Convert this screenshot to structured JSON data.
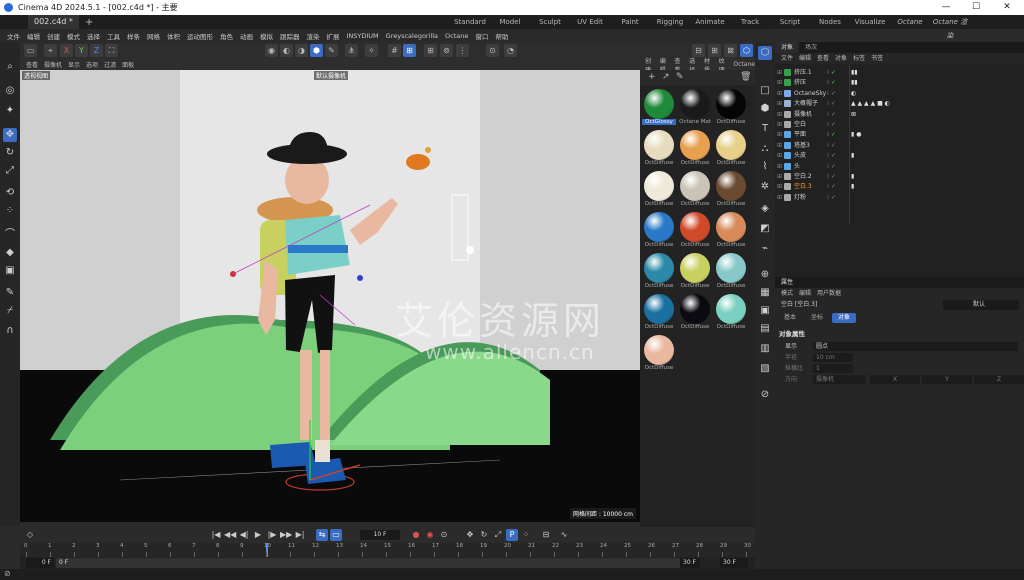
{
  "window": {
    "title": "Cinema 4D 2024.5.1 - [002.c4d *] - 主要",
    "minimize": "—",
    "maximize": "☐",
    "close": "✕"
  },
  "doc_tab": "002.c4d *",
  "add_tab": "+",
  "layouts": [
    "Standard",
    "Model",
    "Sculpt",
    "UV Edit",
    "Paint",
    "Rigging",
    "Animate",
    "Track",
    "Script",
    "Nodes",
    "Visualize",
    "Octane",
    "Octane 渲染"
  ],
  "menu": [
    "文件",
    "编辑",
    "创建",
    "模式",
    "选择",
    "工具",
    "样条",
    "网格",
    "体积",
    "运动图形",
    "角色",
    "动画",
    "模拟",
    "跟踪器",
    "渲染",
    "扩展",
    "INSYDIUM",
    "Greyscalegorilla",
    "Octane",
    "窗口",
    "帮助"
  ],
  "toolbar": {
    "axis_x": "X",
    "axis_y": "Y",
    "axis_z": "Z"
  },
  "viewport": {
    "menu": [
      "查看",
      "摄像机",
      "显示",
      "选项",
      "过滤",
      "面板"
    ],
    "view_label": "透视视图",
    "camera_label": "默认摄像机",
    "grid_info": "网格间距 : 10000 cm",
    "watermark_cn": "艾伦资源网",
    "watermark_url": "www.allencn.cn"
  },
  "materials": {
    "menu": [
      "创建",
      "编辑",
      "查看",
      "选择",
      "材质",
      "纹理",
      "Octane"
    ],
    "items": [
      {
        "name": "OctGlossy",
        "color": "#1f8a3a",
        "selected": true
      },
      {
        "name": "Octane Mat",
        "color": "#1a1a1a"
      },
      {
        "name": "OctDiffuse",
        "color": "#050505"
      },
      {
        "name": "OctDiffuse",
        "color": "#e8dcc0"
      },
      {
        "name": "OctDiffuse",
        "color": "#e8a050"
      },
      {
        "name": "OctDiffuse",
        "color": "#e6d08a"
      },
      {
        "name": "OctDiffuse",
        "color": "#efe9da"
      },
      {
        "name": "OctDiffuse",
        "color": "#c9c4b5"
      },
      {
        "name": "OctDiffuse",
        "color": "#6a4a30"
      },
      {
        "name": "OctDiffuse",
        "color": "#2a78c8"
      },
      {
        "name": "OctDiffuse",
        "color": "#d04a2a"
      },
      {
        "name": "OctDiffuse",
        "color": "#d88a5a"
      },
      {
        "name": "OctDiffuse",
        "color": "#2a8aa8"
      },
      {
        "name": "OctDiffuse",
        "color": "#c8d060"
      },
      {
        "name": "OctDiffuse",
        "color": "#88c8c8"
      },
      {
        "name": "OctDiffuse",
        "color": "#1a70a0"
      },
      {
        "name": "OctDiffuse",
        "color": "#0a0a10"
      },
      {
        "name": "OctDiffuse",
        "color": "#7ad0c0"
      },
      {
        "name": "OctDiffuse",
        "color": "#e8b8a0"
      }
    ]
  },
  "objects": {
    "tabs": [
      "对象",
      "场次"
    ],
    "menu": [
      "文件",
      "编辑",
      "查看",
      "对象",
      "标签",
      "书签"
    ],
    "items": [
      {
        "name": "挤压.1",
        "icon_color": "#37a04a",
        "tags": "▮▮"
      },
      {
        "name": "挤压",
        "icon_color": "#37a04a",
        "tags": "▮▮"
      },
      {
        "name": "OctaneSky",
        "icon_color": "#7aa8e8",
        "tags": "◐"
      },
      {
        "name": "大概帽子",
        "icon_color": "#9ab0d0",
        "tags": "▲ ▲ ▲ ▲ ■ ◐"
      },
      {
        "name": "摄像机",
        "icon_color": "#aaaaaa",
        "tags": "⊠"
      },
      {
        "name": "空白",
        "icon_color": "#aaaaaa",
        "tags": ""
      },
      {
        "name": "平面",
        "icon_color": "#5aa8e8",
        "tags": "▮ ●"
      },
      {
        "name": "塔基3",
        "icon_color": "#5aa8e8",
        "tags": ""
      },
      {
        "name": "头皮",
        "icon_color": "#5aa8e8",
        "tags": "▮"
      },
      {
        "name": "头",
        "icon_color": "#5aa8e8",
        "tags": ""
      },
      {
        "name": "空白.2",
        "icon_color": "#aaaaaa",
        "tags": "▮"
      },
      {
        "name": "空白.3",
        "icon_color": "#aaaaaa",
        "tags": "▮",
        "highlight": true
      },
      {
        "name": "灯粉",
        "icon_color": "#aaaaaa",
        "tags": ""
      }
    ]
  },
  "attributes": {
    "header": "属性",
    "menu": [
      "模式",
      "编辑",
      "用户数据"
    ],
    "object_line": "空白 [空白.3]",
    "preset": "默认",
    "tabs": [
      "基本",
      "坐标",
      "对象"
    ],
    "section": "对象属性",
    "rows": [
      {
        "label": "显示",
        "value": "圆点"
      },
      {
        "label": "半径",
        "value": "10 cm"
      },
      {
        "label": "纵横比",
        "value": "1"
      },
      {
        "label": "方向",
        "value": "摄像机"
      }
    ],
    "dir_axes": [
      "X",
      "Y",
      "Z"
    ]
  },
  "timeline": {
    "current_frame": "10 F",
    "start": "0 F",
    "start2": "0 F",
    "end": "30 F",
    "end2": "30 F",
    "ticks": [
      "0",
      "1",
      "2",
      "3",
      "4",
      "5",
      "6",
      "7",
      "8",
      "9",
      "10",
      "11",
      "12",
      "13",
      "14",
      "15",
      "16",
      "17",
      "18",
      "19",
      "20",
      "21",
      "22",
      "23",
      "24",
      "25",
      "26",
      "27",
      "28",
      "29",
      "30"
    ]
  }
}
